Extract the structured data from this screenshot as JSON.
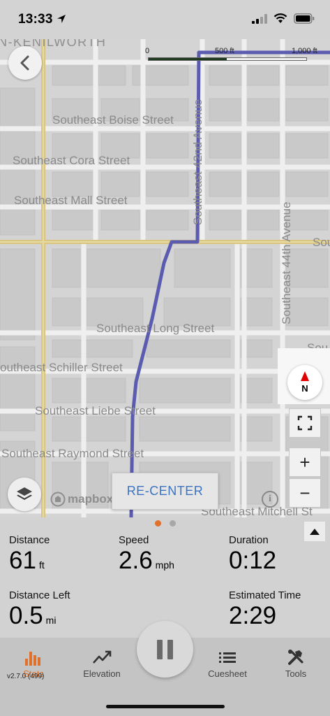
{
  "status_bar": {
    "time": "13:33"
  },
  "map": {
    "neighborhood_label": "N-KENILWORTH",
    "street_labels": {
      "boise": "Southeast Boise Street",
      "cora": "Southeast Cora Street",
      "mall": "Southeast Mall Street",
      "long": "Southeast Long Street",
      "schiller": "outheast Schiller Street",
      "liebe": "Southeast Liebe Street",
      "raymond": "Southeast Raymond Street",
      "mitchell": "Southeast Mitchell St",
      "42nd": "Southeast 42nd Avenue",
      "44th": "Southeast 44th Avenue",
      "sou_top": "Sou",
      "sou_mid": "Sou"
    },
    "scale": {
      "zero": "0",
      "mid": "500 ft",
      "max": "1,000 ft"
    },
    "compass_label": "N",
    "fullscreen_icon": "fullscreen-icon",
    "zoom_in": "+",
    "zoom_out": "−",
    "attribution": "mapbox",
    "info": "i",
    "recenter": "RE-CENTER",
    "route_color": "#5b5bb0"
  },
  "stats": {
    "pager": {
      "active_color": "#e0702a",
      "inactive_color": "#a8a8a8"
    },
    "distance": {
      "label": "Distance",
      "value": "61",
      "unit": "ft"
    },
    "speed": {
      "label": "Speed",
      "value": "2.6",
      "unit": "mph"
    },
    "duration": {
      "label": "Duration",
      "value": "0:12"
    },
    "distance_left": {
      "label": "Distance Left",
      "value": "0.5",
      "unit": "mi"
    },
    "estimated_time": {
      "label": "Estimated Time",
      "value": "2:29"
    }
  },
  "tabbar": {
    "accent": "#e0702a",
    "stats_tab": {
      "label": "Stats",
      "icon": "bar-chart-icon"
    },
    "elevation": {
      "label": "Elevation",
      "icon": "trend-line-icon"
    },
    "cuesheet": {
      "label": "Cuesheet",
      "icon": "list-icon"
    },
    "tools": {
      "label": "Tools",
      "icon": "tools-icon"
    },
    "version": "v2.7.0 (499)"
  }
}
